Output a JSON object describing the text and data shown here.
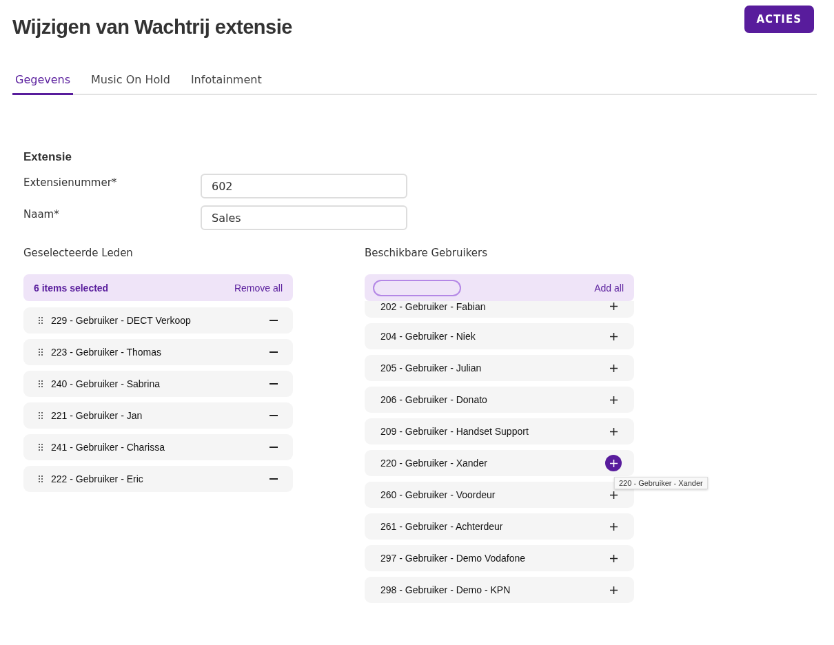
{
  "page": {
    "title": "Wijzigen van Wachtrij extensie",
    "action_button": "ACTIES"
  },
  "tabs": [
    {
      "label": "Gegevens",
      "selected": true
    },
    {
      "label": "Music On Hold",
      "selected": false
    },
    {
      "label": "Infotainment",
      "selected": false
    }
  ],
  "section": {
    "title": "Extensie",
    "fields": [
      {
        "label": "Extensienummer*",
        "value": "602"
      },
      {
        "label": "Naam*",
        "value": "Sales"
      }
    ]
  },
  "selected_members": {
    "title": "Geselecteerde Leden",
    "summary": "6 items selected",
    "remove_all": "Remove all",
    "items": [
      {
        "label": "229 - Gebruiker - DECT Verkoop"
      },
      {
        "label": "223 - Gebruiker - Thomas"
      },
      {
        "label": "240 - Gebruiker - Sabrina"
      },
      {
        "label": "221 - Gebruiker - Jan"
      },
      {
        "label": "241 - Gebruiker - Charissa"
      },
      {
        "label": "222 - Gebruiker - Eric"
      }
    ]
  },
  "available_users": {
    "title": "Beschikbare Gebruikers",
    "filter_focused": true,
    "add_all": "Add all",
    "items": [
      {
        "label": "202 - Gebruiker - Fabian",
        "hovered": false
      },
      {
        "label": "204 - Gebruiker - Niek",
        "hovered": false
      },
      {
        "label": "205 - Gebruiker - Julian",
        "hovered": false
      },
      {
        "label": "206 - Gebruiker - Donato",
        "hovered": false
      },
      {
        "label": "209 - Gebruiker - Handset Support",
        "hovered": false
      },
      {
        "label": "220 - Gebruiker - Xander",
        "hovered": true,
        "tooltip": "220 - Gebruiker - Xander"
      },
      {
        "label": "260 - Gebruiker - Voordeur",
        "hovered": false
      },
      {
        "label": "261 - Gebruiker - Achterdeur",
        "hovered": false
      },
      {
        "label": "297 - Gebruiker - Demo Vodafone",
        "hovered": false
      },
      {
        "label": "298 - Gebruiker - Demo - KPN",
        "hovered": false
      }
    ]
  }
}
